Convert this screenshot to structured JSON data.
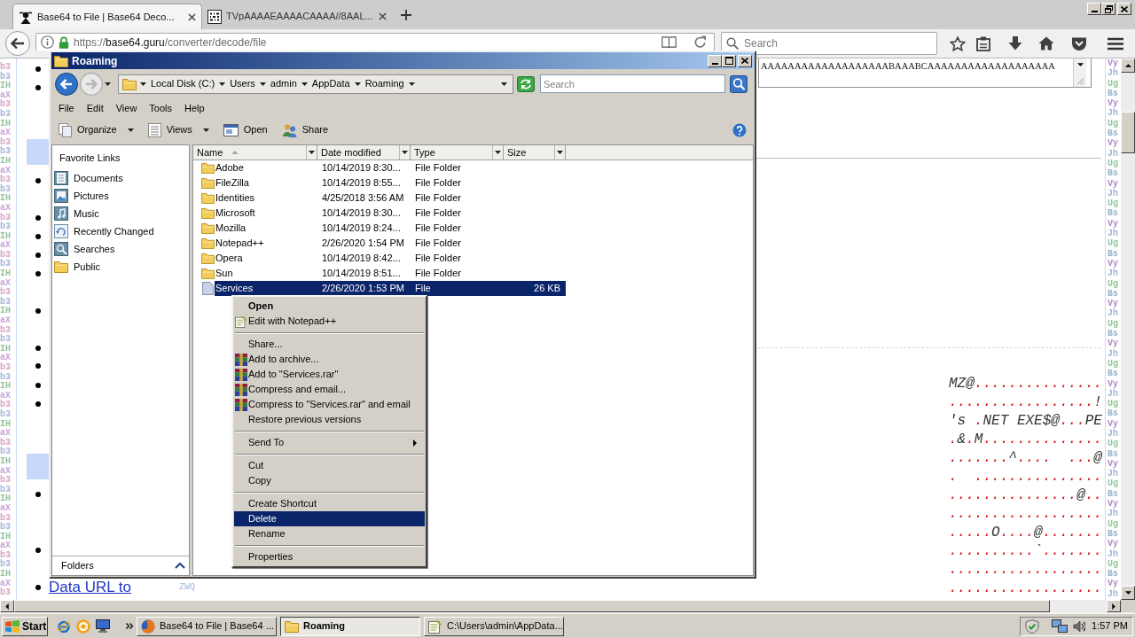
{
  "browser": {
    "tabs": [
      {
        "title": "Base64 to File | Base64 Deco...",
        "selected": true
      },
      {
        "title": "TVpAAAAEAAAACAAAA//8AAL...",
        "selected": false
      }
    ],
    "address": {
      "scheme": "https://",
      "host": "base64.guru",
      "path": "/converter/decode/file"
    },
    "search": {
      "placeholder": "Search"
    }
  },
  "page": {
    "left_gutter": [
      {
        "text": "b3",
        "color": "#d9a3c4"
      },
      {
        "text": "b3",
        "color": "#a3b4d9"
      },
      {
        "text": "IH",
        "color": "#93c49a"
      },
      {
        "text": "aX",
        "color": "#c9a3d9"
      },
      {
        "text": "b3",
        "color": "#d9a3c4"
      },
      {
        "text": "b3",
        "color": "#a3b4d9"
      },
      {
        "text": "IH",
        "color": "#93c49a"
      },
      {
        "text": "aX",
        "color": "#c9a3d9"
      },
      {
        "text": "b3",
        "color": "#d9a3c4"
      },
      {
        "text": "b3",
        "color": "#a3b4d9"
      },
      {
        "text": "IH",
        "color": "#93c49a"
      },
      {
        "text": "aX",
        "color": "#c9a3d9"
      },
      {
        "text": "b3",
        "color": "#d9a3c4"
      },
      {
        "text": "b3",
        "color": "#a3b4d9"
      },
      {
        "text": "IH",
        "color": "#93c49a"
      },
      {
        "text": "aX",
        "color": "#c9a3d9"
      },
      {
        "text": "b3",
        "color": "#d9a3c4"
      },
      {
        "text": "b3",
        "color": "#a3b4d9"
      },
      {
        "text": "IH",
        "color": "#93c49a"
      },
      {
        "text": "aX",
        "color": "#c9a3d9"
      },
      {
        "text": "b3",
        "color": "#d9a3c4"
      },
      {
        "text": "b3",
        "color": "#a3b4d9"
      },
      {
        "text": "IH",
        "color": "#93c49a"
      },
      {
        "text": "aX",
        "color": "#c9a3d9"
      },
      {
        "text": "b3",
        "color": "#d9a3c4"
      },
      {
        "text": "b3",
        "color": "#a3b4d9"
      },
      {
        "text": "IH",
        "color": "#93c49a"
      },
      {
        "text": "aX",
        "color": "#c9a3d9"
      },
      {
        "text": "b3",
        "color": "#d9a3c4"
      },
      {
        "text": "b3",
        "color": "#a3b4d9"
      },
      {
        "text": "IH",
        "color": "#93c49a"
      },
      {
        "text": "aX",
        "color": "#c9a3d9"
      },
      {
        "text": "b3",
        "color": "#d9a3c4"
      },
      {
        "text": "b3",
        "color": "#a3b4d9"
      },
      {
        "text": "IH",
        "color": "#93c49a"
      },
      {
        "text": "aX",
        "color": "#c9a3d9"
      },
      {
        "text": "b3",
        "color": "#d9a3c4"
      },
      {
        "text": "b3",
        "color": "#a3b4d9"
      },
      {
        "text": "IH",
        "color": "#93c49a"
      },
      {
        "text": "aX",
        "color": "#c9a3d9"
      },
      {
        "text": "b3",
        "color": "#d9a3c4"
      },
      {
        "text": "b3",
        "color": "#a3b4d9"
      },
      {
        "text": "IH",
        "color": "#93c49a"
      },
      {
        "text": "aX",
        "color": "#c9a3d9"
      },
      {
        "text": "b3",
        "color": "#d9a3c4"
      },
      {
        "text": "b3",
        "color": "#a3b4d9"
      },
      {
        "text": "IH",
        "color": "#93c49a"
      },
      {
        "text": "aX",
        "color": "#c9a3d9"
      },
      {
        "text": "b3",
        "color": "#d9a3c4"
      },
      {
        "text": "b3",
        "color": "#a3b4d9"
      },
      {
        "text": "IH",
        "color": "#93c49a"
      },
      {
        "text": "aX",
        "color": "#c9a3d9"
      },
      {
        "text": "b3",
        "color": "#d9a3c4"
      },
      {
        "text": "b3",
        "color": "#a3b4d9"
      },
      {
        "text": "IH",
        "color": "#93c49a"
      },
      {
        "text": "aX",
        "color": "#c9a3d9"
      },
      {
        "text": "b3",
        "color": "#d9a3c4"
      }
    ],
    "textarea_line": "AAAAAAAAAAAAAAAAAAABAAABCAAAAAAAAAAAAAAAAAAA",
    "link": "Data URL to",
    "fragment": "ZWQ",
    "hex_dump": [
      "MZ@...............",
      ".................!",
      "'s .NET EXE$@...PE",
      ".&.M..............",
      ".......^....  ...@",
      ".  ...............",
      "...............@..",
      "..................",
      ".....O....@.......",
      "..........`.......",
      "..................",
      ".................."
    ],
    "right_gutter": [
      {
        "text": "Vy",
        "color": "#b58ac9"
      },
      {
        "text": "Jh",
        "color": "#a3b4d9"
      },
      {
        "text": "Ug",
        "color": "#93c49a"
      },
      {
        "text": "Bs",
        "color": "#93b4c9"
      },
      {
        "text": "Vy",
        "color": "#b58ac9"
      },
      {
        "text": "Jh",
        "color": "#a3b4d9"
      },
      {
        "text": "Ug",
        "color": "#93c49a"
      },
      {
        "text": "Bs",
        "color": "#93b4c9"
      },
      {
        "text": "Vy",
        "color": "#b58ac9"
      },
      {
        "text": "Jh",
        "color": "#a3b4d9"
      },
      {
        "text": "Ug",
        "color": "#93c49a"
      },
      {
        "text": "Bs",
        "color": "#93b4c9"
      },
      {
        "text": "Vy",
        "color": "#b58ac9"
      },
      {
        "text": "Jh",
        "color": "#a3b4d9"
      },
      {
        "text": "Ug",
        "color": "#93c49a"
      },
      {
        "text": "Bs",
        "color": "#93b4c9"
      },
      {
        "text": "Vy",
        "color": "#b58ac9"
      },
      {
        "text": "Jh",
        "color": "#a3b4d9"
      },
      {
        "text": "Ug",
        "color": "#93c49a"
      },
      {
        "text": "Bs",
        "color": "#93b4c9"
      },
      {
        "text": "Vy",
        "color": "#b58ac9"
      },
      {
        "text": "Jh",
        "color": "#a3b4d9"
      },
      {
        "text": "Ug",
        "color": "#93c49a"
      },
      {
        "text": "Bs",
        "color": "#93b4c9"
      },
      {
        "text": "Vy",
        "color": "#b58ac9"
      },
      {
        "text": "Jh",
        "color": "#a3b4d9"
      },
      {
        "text": "Ug",
        "color": "#93c49a"
      },
      {
        "text": "Bs",
        "color": "#93b4c9"
      },
      {
        "text": "Vy",
        "color": "#b58ac9"
      },
      {
        "text": "Jh",
        "color": "#a3b4d9"
      },
      {
        "text": "Ug",
        "color": "#93c49a"
      },
      {
        "text": "Bs",
        "color": "#93b4c9"
      },
      {
        "text": "Vy",
        "color": "#b58ac9"
      },
      {
        "text": "Jh",
        "color": "#a3b4d9"
      },
      {
        "text": "Ug",
        "color": "#93c49a"
      },
      {
        "text": "Bs",
        "color": "#93b4c9"
      },
      {
        "text": "Vy",
        "color": "#b58ac9"
      },
      {
        "text": "Jh",
        "color": "#a3b4d9"
      },
      {
        "text": "Ug",
        "color": "#93c49a"
      },
      {
        "text": "Bs",
        "color": "#93b4c9"
      },
      {
        "text": "Vy",
        "color": "#b58ac9"
      },
      {
        "text": "Jh",
        "color": "#a3b4d9"
      },
      {
        "text": "Ug",
        "color": "#93c49a"
      },
      {
        "text": "Bs",
        "color": "#93b4c9"
      },
      {
        "text": "Vy",
        "color": "#b58ac9"
      },
      {
        "text": "Jh",
        "color": "#a3b4d9"
      },
      {
        "text": "Ug",
        "color": "#93c49a"
      },
      {
        "text": "Bs",
        "color": "#93b4c9"
      },
      {
        "text": "Vy",
        "color": "#b58ac9"
      },
      {
        "text": "Jh",
        "color": "#a3b4d9"
      },
      {
        "text": "Ug",
        "color": "#93c49a"
      },
      {
        "text": "Bs",
        "color": "#93b4c9"
      },
      {
        "text": "Vy",
        "color": "#b58ac9"
      },
      {
        "text": "Jh",
        "color": "#a3b4d9"
      }
    ]
  },
  "explorer": {
    "title": "Roaming",
    "breadcrumb": [
      "Local Disk (C:)",
      "Users",
      "admin",
      "AppData",
      "Roaming"
    ],
    "search": {
      "placeholder": "Search"
    },
    "menu": [
      "File",
      "Edit",
      "View",
      "Tools",
      "Help"
    ],
    "toolbar": [
      {
        "kind": "organize",
        "label": "Organize",
        "dropdown": true
      },
      {
        "kind": "views",
        "label": "Views",
        "dropdown": true
      },
      {
        "kind": "open",
        "label": "Open",
        "dropdown": false
      },
      {
        "kind": "share",
        "label": "Share",
        "dropdown": false
      }
    ],
    "favorites": {
      "title": "Favorite Links",
      "items": [
        {
          "kind": "documents",
          "label": "Documents"
        },
        {
          "kind": "pictures",
          "label": "Pictures"
        },
        {
          "kind": "music",
          "label": "Music"
        },
        {
          "kind": "recent",
          "label": "Recently Changed"
        },
        {
          "kind": "searches",
          "label": "Searches"
        },
        {
          "kind": "folder",
          "label": "Public"
        }
      ]
    },
    "folders_label": "Folders",
    "columns": [
      {
        "label": "Name",
        "sorted": true
      },
      {
        "label": "Date modified",
        "sorted": false
      },
      {
        "label": "Type",
        "sorted": false
      },
      {
        "label": "Size",
        "sorted": false
      }
    ],
    "rows": [
      {
        "kind": "folder",
        "name": "Adobe",
        "date": "10/14/2019 8:30...",
        "type": "File Folder",
        "selected": false
      },
      {
        "kind": "folder",
        "name": "FileZilla",
        "date": "10/14/2019 8:55...",
        "type": "File Folder",
        "selected": false
      },
      {
        "kind": "folder",
        "name": "Identities",
        "date": "4/25/2018 3:56 AM",
        "type": "File Folder",
        "selected": false
      },
      {
        "kind": "folder",
        "name": "Microsoft",
        "date": "10/14/2019 8:30...",
        "type": "File Folder",
        "selected": false
      },
      {
        "kind": "folder",
        "name": "Mozilla",
        "date": "10/14/2019 8:24...",
        "type": "File Folder",
        "selected": false
      },
      {
        "kind": "folder",
        "name": "Notepad++",
        "date": "2/26/2020 1:54 PM",
        "type": "File Folder",
        "selected": false
      },
      {
        "kind": "folder",
        "name": "Opera",
        "date": "10/14/2019 8:42...",
        "type": "File Folder",
        "selected": false
      },
      {
        "kind": "folder",
        "name": "Sun",
        "date": "10/14/2019 8:51...",
        "type": "File Folder",
        "selected": false
      },
      {
        "kind": "file",
        "name": "Services",
        "date": "2/26/2020 1:53 PM",
        "type": "File",
        "size": "26 KB",
        "selected": true
      }
    ]
  },
  "context_menu": [
    {
      "kind": "plain",
      "label": "Open",
      "default": true,
      "selected": false
    },
    {
      "kind": "notepad",
      "label": "Edit with Notepad++",
      "default": false,
      "selected": false
    },
    {
      "kind": "separator"
    },
    {
      "kind": "plain",
      "label": "Share...",
      "default": false,
      "selected": false
    },
    {
      "kind": "archive",
      "label": "Add to archive...",
      "default": false,
      "selected": false
    },
    {
      "kind": "archive",
      "label": "Add to \"Services.rar\"",
      "default": false,
      "selected": false
    },
    {
      "kind": "archive",
      "label": "Compress and email...",
      "default": false,
      "selected": false
    },
    {
      "kind": "archive",
      "label": "Compress to \"Services.rar\" and email",
      "default": false,
      "selected": false
    },
    {
      "kind": "plain",
      "label": "Restore previous versions",
      "default": false,
      "selected": false
    },
    {
      "kind": "separator"
    },
    {
      "kind": "submenu",
      "label": "Send To",
      "default": false,
      "selected": false
    },
    {
      "kind": "separator"
    },
    {
      "kind": "plain",
      "label": "Cut",
      "default": false,
      "selected": false
    },
    {
      "kind": "plain",
      "label": "Copy",
      "default": false,
      "selected": false
    },
    {
      "kind": "separator"
    },
    {
      "kind": "plain",
      "label": "Create Shortcut",
      "default": false,
      "selected": false
    },
    {
      "kind": "plain",
      "label": "Delete",
      "default": false,
      "selected": true
    },
    {
      "kind": "plain",
      "label": "Rename",
      "default": false,
      "selected": false
    },
    {
      "kind": "separator"
    },
    {
      "kind": "plain",
      "label": "Properties",
      "default": false,
      "selected": false
    }
  ],
  "taskbar": {
    "start": "Start",
    "tasks": [
      {
        "kind": "browser",
        "label": "Base64 to File | Base64 ...",
        "selected": false
      },
      {
        "kind": "folder",
        "label": "Roaming",
        "selected": true
      },
      {
        "kind": "notepad",
        "label": "C:\\Users\\admin\\AppData...",
        "selected": false
      }
    ],
    "clock": "1:57 PM"
  }
}
